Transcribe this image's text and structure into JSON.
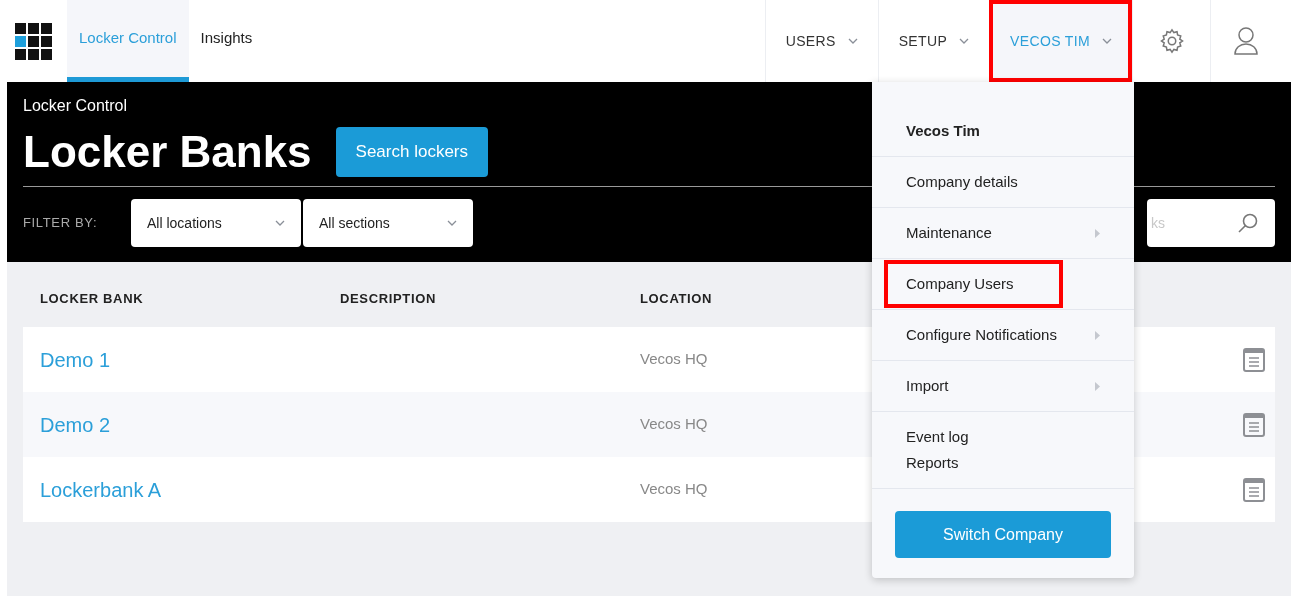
{
  "nav": {
    "tabs": [
      {
        "label": "Locker Control",
        "selected": true
      },
      {
        "label": "Insights",
        "selected": false
      }
    ],
    "menus": [
      {
        "label": "USERS",
        "selected": false,
        "highlighted": false
      },
      {
        "label": "SETUP",
        "selected": false,
        "highlighted": false
      },
      {
        "label": "VECOS TIM",
        "selected": true,
        "highlighted": true
      }
    ]
  },
  "header": {
    "breadcrumb": "Locker Control",
    "title": "Locker Banks",
    "search_button": "Search lockers",
    "filter_label": "FILTER BY:",
    "filters": [
      "All locations",
      "All sections"
    ],
    "search": {
      "placeholder": "ks"
    }
  },
  "table": {
    "columns": [
      "LOCKER BANK",
      "DESCRIPTION",
      "LOCATION"
    ],
    "rows": [
      {
        "name": "Demo 1",
        "location": "Vecos HQ"
      },
      {
        "name": "Demo 2",
        "location": "Vecos HQ"
      },
      {
        "name": "Lockerbank A",
        "location": "Vecos HQ"
      }
    ]
  },
  "user_menu": {
    "groups": [
      [
        {
          "kind": "heading",
          "label": "Vecos Tim",
          "submenu": false,
          "highlighted": false
        }
      ],
      [
        {
          "kind": "item",
          "label": "Company details",
          "submenu": false,
          "highlighted": false
        }
      ],
      [
        {
          "kind": "item",
          "label": "Maintenance",
          "submenu": true,
          "highlighted": false
        }
      ],
      [
        {
          "kind": "item",
          "label": "Company Users",
          "submenu": false,
          "highlighted": true
        }
      ],
      [
        {
          "kind": "item",
          "label": "Configure Notifications",
          "submenu": true,
          "highlighted": false
        }
      ],
      [
        {
          "kind": "item",
          "label": "Import",
          "submenu": true,
          "highlighted": false
        }
      ],
      [
        {
          "kind": "item",
          "label": "Event log",
          "submenu": false,
          "highlighted": false
        },
        {
          "kind": "item",
          "label": "Reports",
          "submenu": false,
          "highlighted": false
        }
      ]
    ],
    "button": "Switch Company"
  }
}
